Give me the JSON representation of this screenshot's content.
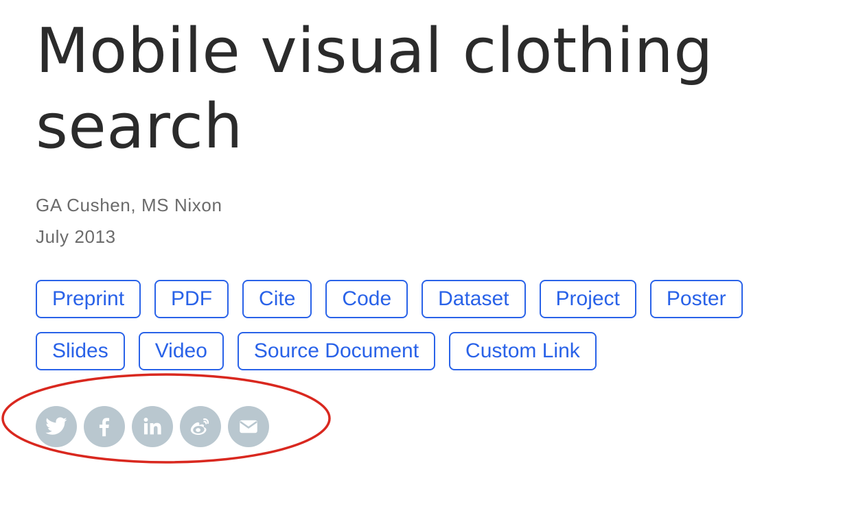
{
  "publication": {
    "title": "Mobile visual clothing search",
    "authors": "GA Cushen, MS Nixon",
    "date": "July 2013"
  },
  "links": [
    {
      "label": "Preprint"
    },
    {
      "label": "PDF"
    },
    {
      "label": "Cite"
    },
    {
      "label": "Code"
    },
    {
      "label": "Dataset"
    },
    {
      "label": "Project"
    },
    {
      "label": "Poster"
    },
    {
      "label": "Slides"
    },
    {
      "label": "Video"
    },
    {
      "label": "Source Document"
    },
    {
      "label": "Custom Link"
    }
  ],
  "share": [
    {
      "icon": "twitter-icon"
    },
    {
      "icon": "facebook-icon"
    },
    {
      "icon": "linkedin-icon"
    },
    {
      "icon": "weibo-icon"
    },
    {
      "icon": "email-icon"
    }
  ],
  "colors": {
    "title": "#2b2b2b",
    "meta": "#6b6b6b",
    "link_accent": "#2962e8",
    "share_icon_bg": "#b9c7cf",
    "annotation": "#d9281f"
  }
}
